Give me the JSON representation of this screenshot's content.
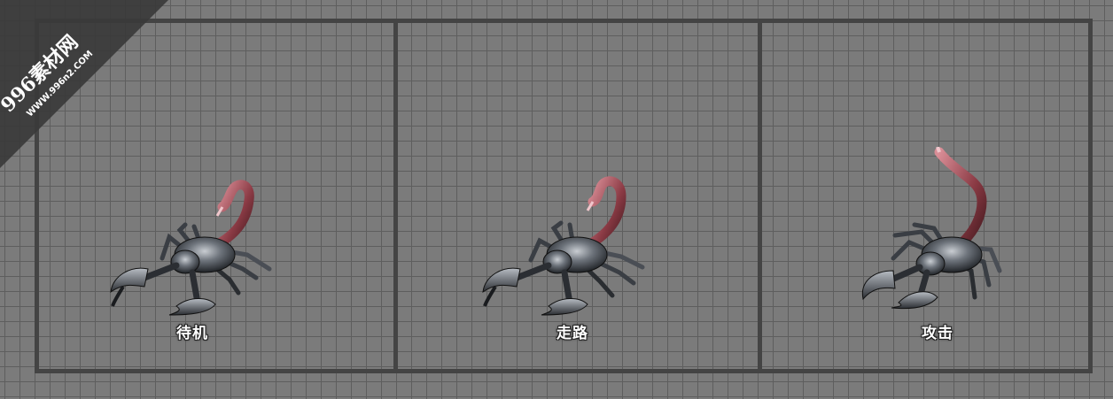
{
  "watermark": {
    "brand": "996素材网",
    "url": "WWW.996n2.COM"
  },
  "panels": [
    {
      "label": "待机",
      "pose": "idle"
    },
    {
      "label": "走路",
      "pose": "walk"
    },
    {
      "label": "攻击",
      "pose": "attack"
    }
  ],
  "colors": {
    "background": "#7b7b7b",
    "grid": "#5e5e5e",
    "frame": "#444444",
    "label": "#ffffff",
    "watermark_bg": "#3a3a3a"
  },
  "icons": {
    "sprite": "scorpion-sprite",
    "watermark": "watermark-logo"
  }
}
